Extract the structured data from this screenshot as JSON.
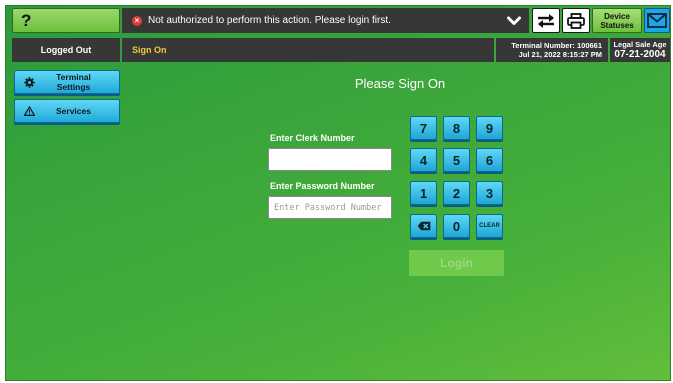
{
  "top_bar": {
    "help_label": "?",
    "notice_text": "Not authorized to perform this action. Please login first.",
    "device_statuses_line1": "Device",
    "device_statuses_line2": "Statuses"
  },
  "status_bar": {
    "session_status": "Logged Out",
    "breadcrumb": "Sign On",
    "terminal_number": "Terminal Number: 100661",
    "datetime": "Jul 21, 2022 8:15:27 PM",
    "legal_age_label": "Legal Sale Age",
    "legal_age_date": "07-21-2004"
  },
  "sidebar": {
    "items": [
      {
        "label": "Terminal Settings",
        "icon": "gear-icon"
      },
      {
        "label": "Services",
        "icon": "warning-icon"
      }
    ]
  },
  "sign_on": {
    "title": "Please Sign On",
    "clerk_label": "Enter Clerk Number",
    "clerk_value": "",
    "clerk_placeholder": "",
    "password_label": "Enter Password Number",
    "password_value": "",
    "password_placeholder": "Enter Password Number",
    "login_label": "Login"
  },
  "keypad": {
    "keys": [
      "7",
      "8",
      "9",
      "4",
      "5",
      "6",
      "1",
      "2",
      "3",
      "",
      "0",
      "CLEAR"
    ]
  },
  "colors": {
    "accent_blue": "#1ea6d6",
    "bar_dark": "#373737",
    "breadcrumb_yellow": "#f0c93a",
    "background_green": "#3aa53b",
    "error_red": "#e23b3b"
  }
}
